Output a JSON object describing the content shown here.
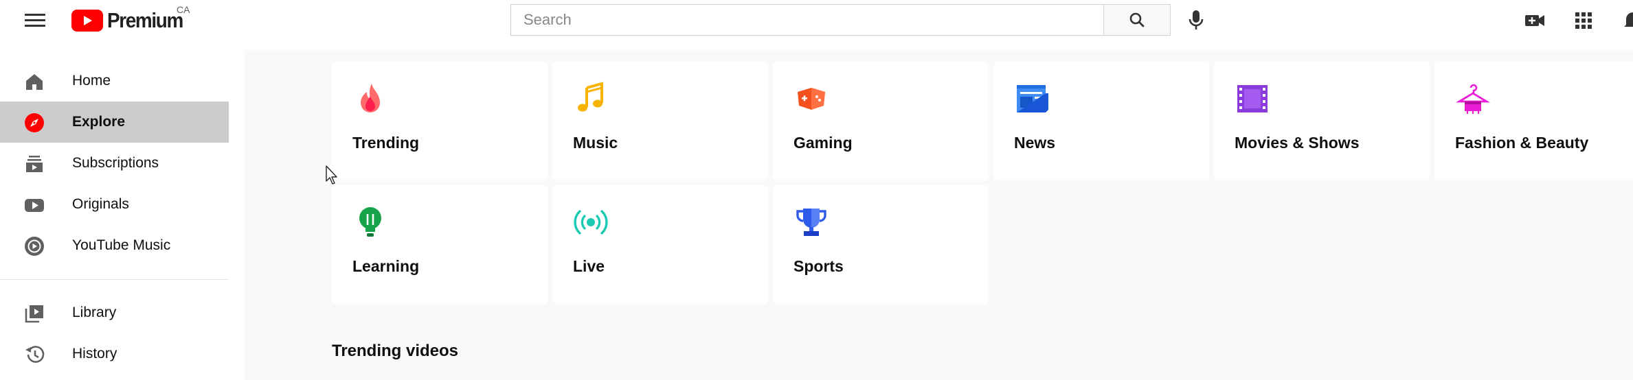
{
  "masthead": {
    "logo_text": "Premium",
    "country_code": "CA",
    "search_placeholder": "Search",
    "search_value": ""
  },
  "colors": {
    "brand_red": "#ff0000",
    "active_bg": "#cccccc",
    "main_bg": "#f9f9f9"
  },
  "sidebar": {
    "items": [
      {
        "label": "Home",
        "icon": "home-icon"
      },
      {
        "label": "Explore",
        "icon": "compass-icon",
        "active": true
      },
      {
        "label": "Subscriptions",
        "icon": "subscriptions-icon"
      },
      {
        "label": "Originals",
        "icon": "originals-icon"
      },
      {
        "label": "YouTube Music",
        "icon": "youtube-music-icon"
      },
      {
        "label": "Library",
        "icon": "library-icon"
      },
      {
        "label": "History",
        "icon": "history-icon"
      }
    ]
  },
  "explore": {
    "categories": [
      {
        "label": "Trending",
        "icon": "flame-icon",
        "color": "#ff4e45"
      },
      {
        "label": "Music",
        "icon": "music-note-icon",
        "color": "#f6b300"
      },
      {
        "label": "Gaming",
        "icon": "game-controller-icon",
        "color": "#f4511e"
      },
      {
        "label": "News",
        "icon": "newspaper-icon",
        "color": "#3f8cf5"
      },
      {
        "label": "Movies & Shows",
        "icon": "film-strip-icon",
        "color": "#8a3ddc"
      },
      {
        "label": "Fashion & Beauty",
        "icon": "hanger-icon",
        "color": "#e91ed5"
      },
      {
        "label": "Learning",
        "icon": "lightbulb-icon",
        "color": "#16a34a"
      },
      {
        "label": "Live",
        "icon": "live-broadcast-icon",
        "color": "#1ec9b4"
      },
      {
        "label": "Sports",
        "icon": "trophy-icon",
        "color": "#2f5bea"
      }
    ],
    "section_title": "Trending videos"
  }
}
